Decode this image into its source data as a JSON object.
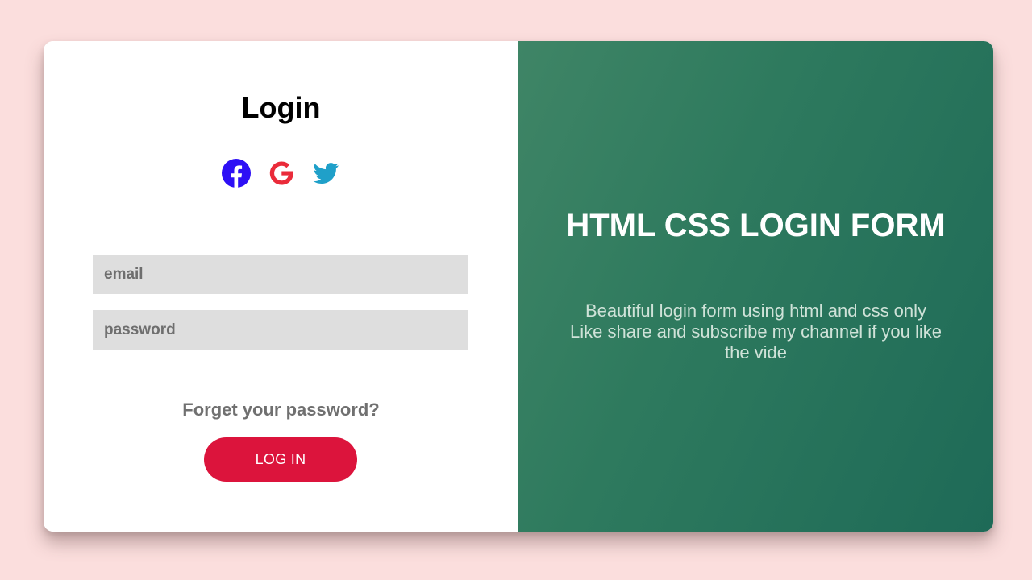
{
  "login": {
    "title": "Login",
    "social": {
      "facebook_icon": "facebook-icon",
      "google_icon": "google-icon",
      "twitter_icon": "twitter-icon"
    },
    "email_placeholder": "email",
    "password_placeholder": "password",
    "forgot_label": "Forget your password?",
    "login_button_label": "LOG IN"
  },
  "promo": {
    "title": "HTML CSS LOGIN FORM",
    "text": "Beautiful login form using html and css only Like share and subscribe my channel if you like the vide"
  },
  "colors": {
    "background": "#fbdedd",
    "accent": "#dc143c",
    "panel_green": "#2e7a5e",
    "facebook": "#2d0ff5",
    "google": "#ea2b3a",
    "twitter": "#1fa0c9",
    "input_bg": "#dedede"
  }
}
